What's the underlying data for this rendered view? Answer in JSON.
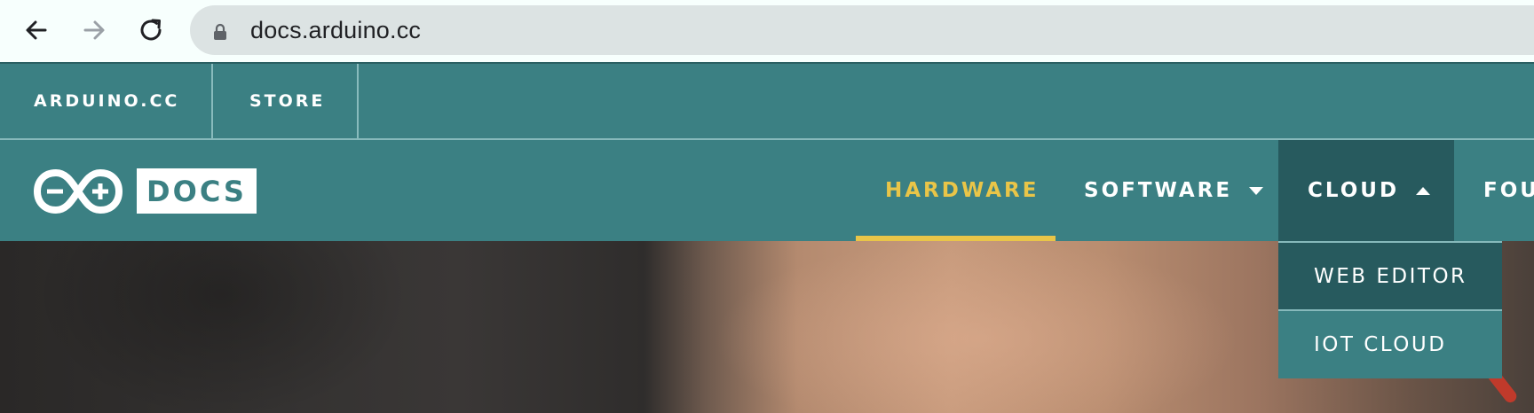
{
  "browser": {
    "url": "docs.arduino.cc",
    "icons": [
      "back-arrow-icon",
      "forward-arrow-icon",
      "reload-icon",
      "lock-icon"
    ]
  },
  "topbar": {
    "arduino_label": "ARDUINO.CC",
    "store_label": "STORE"
  },
  "brand": {
    "docs_label": "DOCS"
  },
  "nav": {
    "hardware": "HARDWARE",
    "software": "SOFTWARE",
    "cloud": "CLOUD",
    "partial": "FOU"
  },
  "cloud_menu": {
    "items": [
      {
        "label": "WEB EDITOR"
      },
      {
        "label": "IOT CLOUD"
      }
    ]
  },
  "colors": {
    "teal": "#3b8083",
    "teal_dark": "#275a5e",
    "accent_yellow": "#e9c548"
  }
}
